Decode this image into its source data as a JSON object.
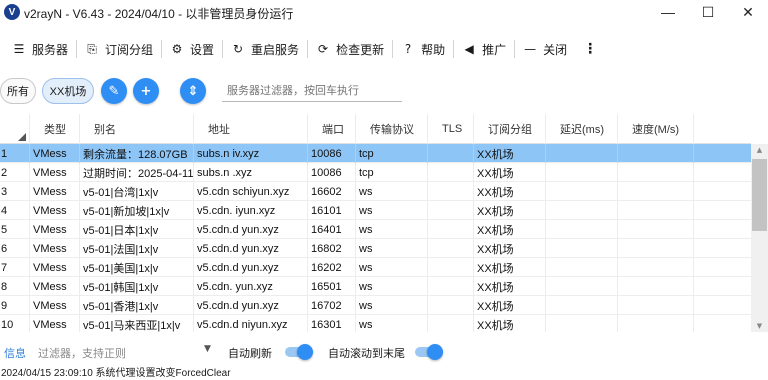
{
  "window": {
    "title": "v2rayN - V6.43 - 2024/04/10 - 以非管理员身份运行",
    "app_icon": "V",
    "minimize_icon": "—",
    "maximize_icon": "☐",
    "close_icon": "✕"
  },
  "toolbar": {
    "items": [
      {
        "icon": "server-icon",
        "glyph": "☰",
        "label": "服务器"
      },
      {
        "icon": "subscription-icon",
        "glyph": "⎘",
        "label": "订阅分组"
      },
      {
        "icon": "gear-icon",
        "glyph": "⚙",
        "label": "设置"
      },
      {
        "icon": "restart-icon",
        "glyph": "↻",
        "label": "重启服务"
      },
      {
        "icon": "update-icon",
        "glyph": "⟳",
        "label": "检查更新"
      },
      {
        "icon": "help-icon",
        "glyph": "?",
        "label": "帮助"
      },
      {
        "icon": "promote-icon",
        "glyph": "◀",
        "label": "推广"
      },
      {
        "icon": "close-icon",
        "glyph": "—",
        "label": "关闭"
      }
    ],
    "more_glyph": "⋮"
  },
  "filter": {
    "all_label": "所有",
    "subscription_label": "XX机场",
    "edit_glyph": "✎",
    "add_glyph": "+",
    "sort_glyph": "⇕",
    "placeholder": "服务器过滤器，按回车执行"
  },
  "grid": {
    "columns": [
      "",
      "类型",
      "别名",
      "地址",
      "端口",
      "传输协议",
      "TLS",
      "订阅分组",
      "延迟(ms)",
      "速度(M/s)"
    ],
    "rows": [
      {
        "num": "1",
        "type": "VMess",
        "alias": "剩余流量：128.07GB",
        "address": "subs.n  iv.xyz",
        "port": "10086",
        "transport": "tcp",
        "tls": "",
        "sub": "XX机场",
        "delay": "",
        "speed": "",
        "selected": true
      },
      {
        "num": "2",
        "type": "VMess",
        "alias": "过期时间：2025-04-11",
        "address": "subs.n   .xyz",
        "port": "10086",
        "transport": "tcp",
        "tls": "",
        "sub": "XX机场",
        "delay": "",
        "speed": "",
        "selected": false
      },
      {
        "num": "3",
        "type": "VMess",
        "alias": "v5-01|台湾|1x|v",
        "address": "v5.cdn   schiyun.xyz",
        "port": "16602",
        "transport": "ws",
        "tls": "",
        "sub": "XX机场",
        "delay": "",
        "speed": "",
        "selected": false
      },
      {
        "num": "4",
        "type": "VMess",
        "alias": "v5-01|新加坡|1x|v",
        "address": "v5.cdn.   iyun.xyz",
        "port": "16101",
        "transport": "ws",
        "tls": "",
        "sub": "XX机场",
        "delay": "",
        "speed": "",
        "selected": false
      },
      {
        "num": "5",
        "type": "VMess",
        "alias": "v5-01|日本|1x|v",
        "address": "v5.cdn.d   yun.xyz",
        "port": "16401",
        "transport": "ws",
        "tls": "",
        "sub": "XX机场",
        "delay": "",
        "speed": "",
        "selected": false
      },
      {
        "num": "6",
        "type": "VMess",
        "alias": "v5-01|法国|1x|v",
        "address": "v5.cdn.d   yun.xyz",
        "port": "16802",
        "transport": "ws",
        "tls": "",
        "sub": "XX机场",
        "delay": "",
        "speed": "",
        "selected": false
      },
      {
        "num": "7",
        "type": "VMess",
        "alias": "v5-01|美国|1x|v",
        "address": "v5.cdn.d   yun.xyz",
        "port": "16202",
        "transport": "ws",
        "tls": "",
        "sub": "XX机场",
        "delay": "",
        "speed": "",
        "selected": false
      },
      {
        "num": "8",
        "type": "VMess",
        "alias": "v5-01|韩国|1x|v",
        "address": "v5.cdn.   yun.xyz",
        "port": "16501",
        "transport": "ws",
        "tls": "",
        "sub": "XX机场",
        "delay": "",
        "speed": "",
        "selected": false
      },
      {
        "num": "9",
        "type": "VMess",
        "alias": "v5-01|香港|1x|v",
        "address": "v5.cdn.d   yun.xyz",
        "port": "16702",
        "transport": "ws",
        "tls": "",
        "sub": "XX机场",
        "delay": "",
        "speed": "",
        "selected": false
      },
      {
        "num": "10",
        "type": "VMess",
        "alias": "v5-01|马来西亚|1x|v",
        "address": "v5.cdn.d   niyun.xyz",
        "port": "16301",
        "transport": "ws",
        "tls": "",
        "sub": "XX机场",
        "delay": "",
        "speed": "",
        "selected": false
      }
    ]
  },
  "scrollbar": {
    "up_glyph": "▲",
    "down_glyph": "▼"
  },
  "bottom": {
    "info_label": "信息",
    "filter_placeholder": "过滤器，支持正则",
    "dropdown_glyph": "▼",
    "auto_refresh_label": "自动刷新",
    "auto_scroll_label": "自动滚动到末尾",
    "auto_refresh_on": true,
    "auto_scroll_on": true
  },
  "status": {
    "text": "2024/04/15 23:09:10 系统代理设置改变ForcedClear"
  },
  "colors": {
    "accent": "#2f8ef4",
    "selected_row": "#8ec5f7",
    "info_label": "#2f7fd6"
  }
}
